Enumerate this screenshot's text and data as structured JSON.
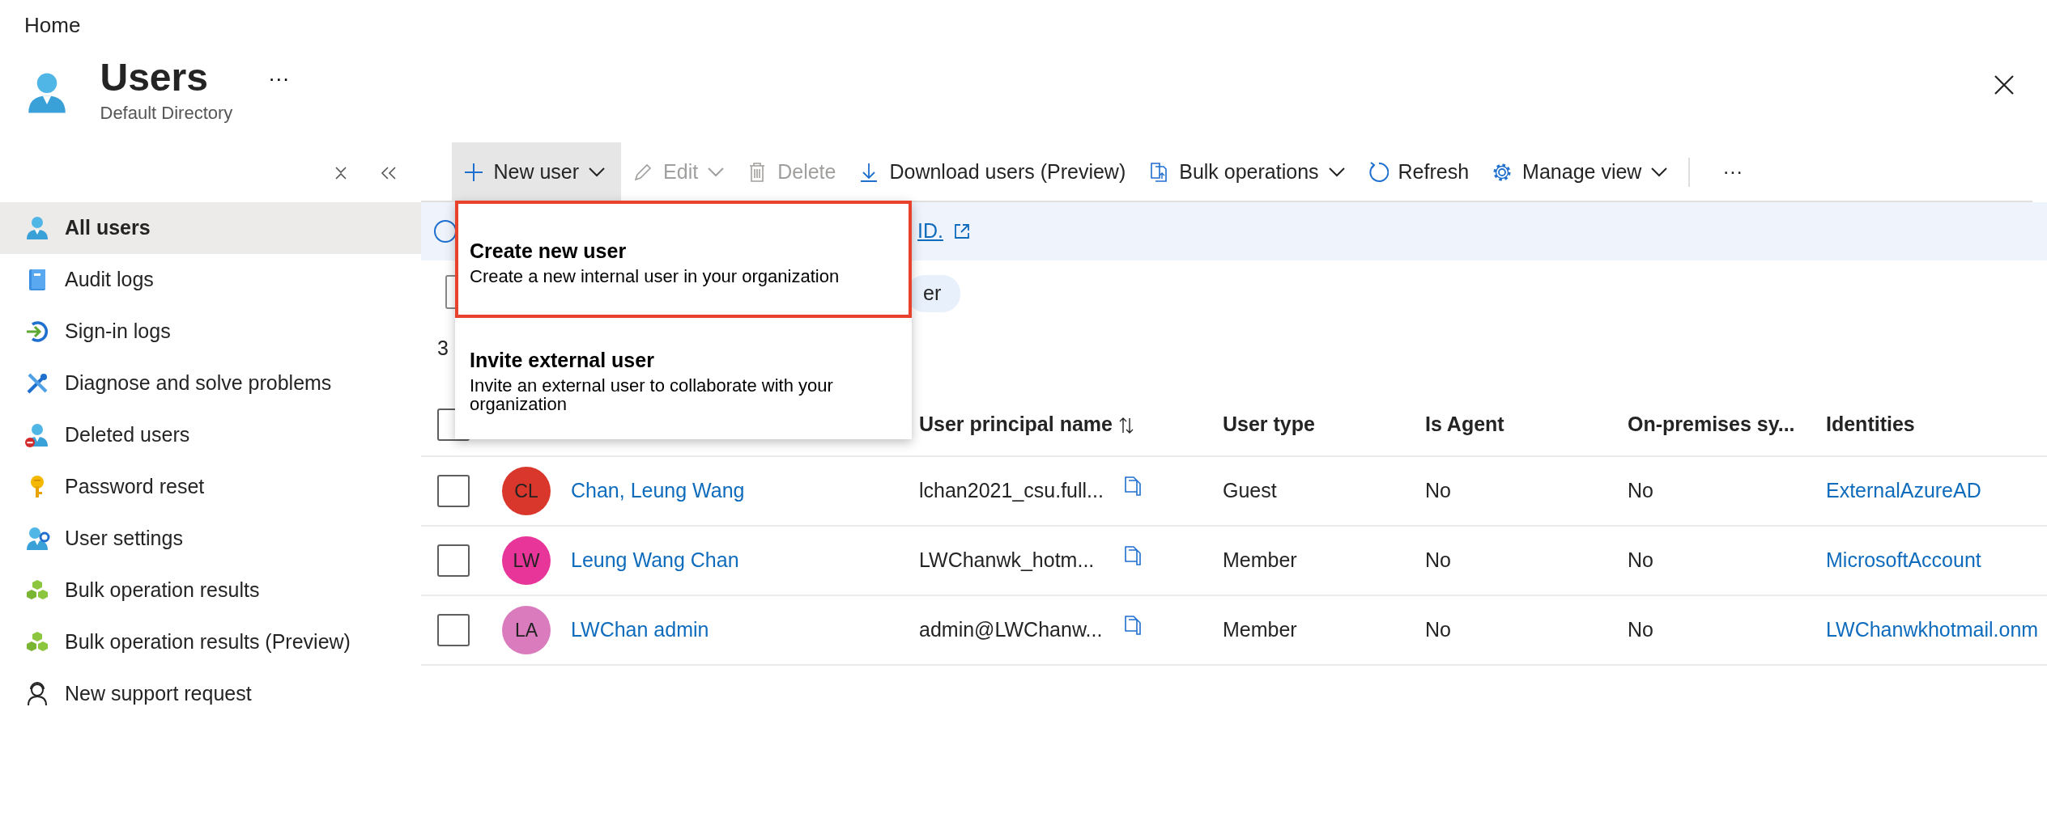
{
  "breadcrumb": "Home",
  "header": {
    "title": "Users",
    "subtitle": "Default Directory",
    "more": "···"
  },
  "sidebar": {
    "items": [
      {
        "label": "All users",
        "selected": true
      },
      {
        "label": "Audit logs",
        "selected": false
      },
      {
        "label": "Sign-in logs",
        "selected": false
      },
      {
        "label": "Diagnose and solve problems",
        "selected": false
      },
      {
        "label": "Deleted users",
        "selected": false
      },
      {
        "label": "Password reset",
        "selected": false
      },
      {
        "label": "User settings",
        "selected": false
      },
      {
        "label": "Bulk operation results",
        "selected": false
      },
      {
        "label": "Bulk operation results (Preview)",
        "selected": false
      },
      {
        "label": "New support request",
        "selected": false
      }
    ]
  },
  "toolbar": {
    "items": [
      {
        "label": "New user",
        "dropdown": true,
        "disabled": false,
        "expanded": true
      },
      {
        "label": "Edit",
        "dropdown": true,
        "disabled": true,
        "expanded": false
      },
      {
        "label": "Delete",
        "dropdown": false,
        "disabled": true,
        "expanded": false
      },
      {
        "label": "Download users (Preview)",
        "dropdown": false,
        "disabled": false,
        "expanded": false
      },
      {
        "label": "Bulk operations",
        "dropdown": true,
        "disabled": false,
        "expanded": false
      },
      {
        "label": "Refresh",
        "dropdown": false,
        "disabled": false,
        "expanded": false
      },
      {
        "label": "Manage view",
        "dropdown": true,
        "disabled": false,
        "expanded": false
      }
    ],
    "more": "···"
  },
  "new_user_menu": [
    {
      "title": "Create new user",
      "description": "Create a new internal user in your organization",
      "selected": true
    },
    {
      "title": "Invite external user",
      "description": "Invite an external user to collaborate with your organization",
      "selected": false
    }
  ],
  "info_bar": {
    "link": "ID."
  },
  "filter_pill": "er",
  "count": "3",
  "table": {
    "select_all_checked": false,
    "columns": [
      "",
      "User principal name",
      "User type",
      "Is Agent",
      "On-premises sy...",
      "Identities"
    ],
    "rows": [
      {
        "checked": false,
        "initials": "CL",
        "color": "#d9372b",
        "name": "Chan, Leung Wang",
        "upn": "lchan2021_csu.full...",
        "user_type": "Guest",
        "is_agent": "No",
        "on_premises": "No",
        "identities": "ExternalAzureAD"
      },
      {
        "checked": false,
        "initials": "LW",
        "color": "#e8359a",
        "name": "Leung Wang Chan",
        "upn": "LWChanwk_hotm...",
        "user_type": "Member",
        "is_agent": "No",
        "on_premises": "No",
        "identities": "MicrosoftAccount"
      },
      {
        "checked": false,
        "initials": "LA",
        "color": "#d97bbd",
        "name": "LWChan admin",
        "upn": "admin@LWChanw...",
        "user_type": "Member",
        "is_agent": "No",
        "on_premises": "No",
        "identities": "LWChanwkhotmail.onm"
      }
    ]
  }
}
